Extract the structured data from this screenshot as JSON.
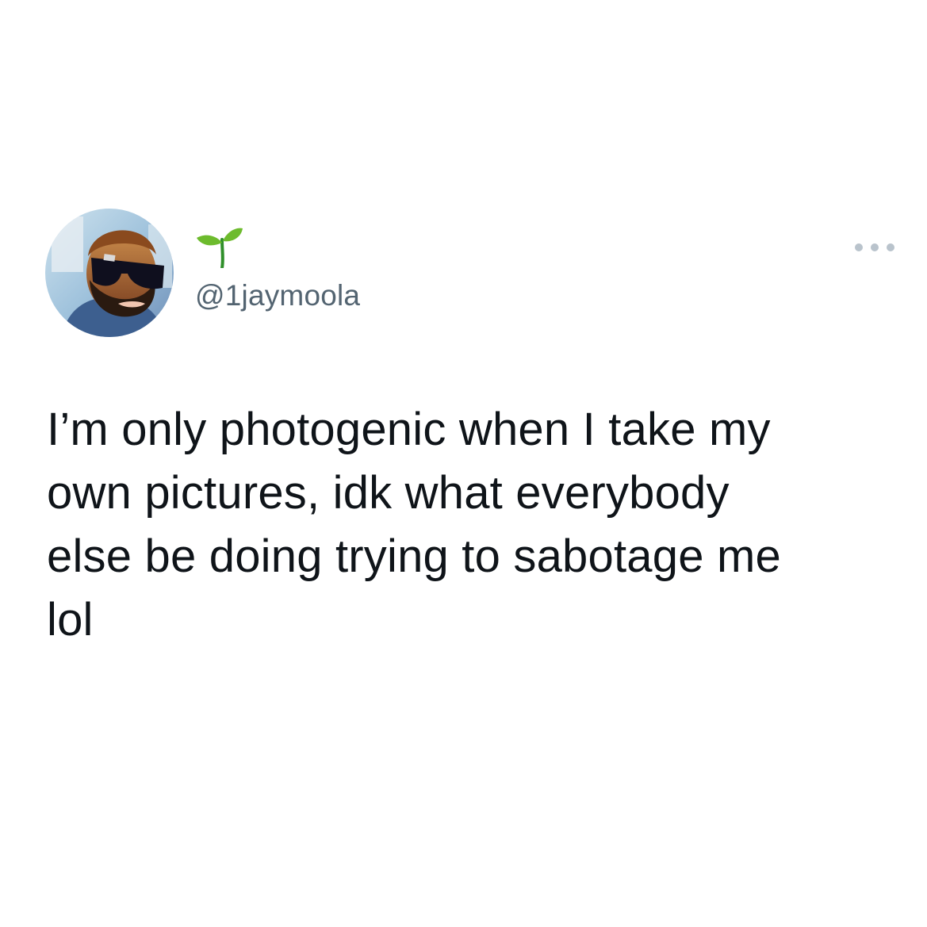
{
  "tweet": {
    "display_name_icon": "seedling-icon",
    "handle": "@1jaymoola",
    "more_icon": "more-options-icon",
    "text_lines": [
      "I’m only photogenic when I take my",
      "own pictures, idk what everybody",
      "else be doing trying to sabotage me",
      "lol"
    ]
  },
  "colors": {
    "background": "#ffffff",
    "text": "#0f1419",
    "handle": "#536471",
    "more_dots": "#b9c3cc",
    "seedling": "#6dbb2d"
  }
}
